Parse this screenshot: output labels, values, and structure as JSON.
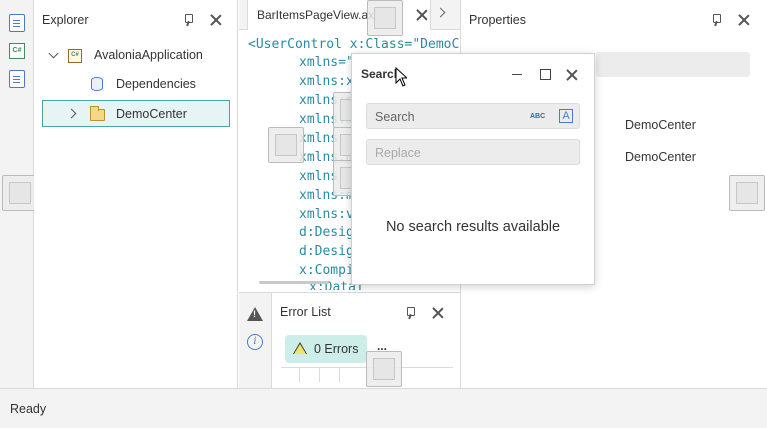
{
  "explorer": {
    "title": "Explorer",
    "tree": [
      {
        "label": "AvaloniaApplication",
        "icon": "csharp-project-icon",
        "expanded": true
      },
      {
        "label": "Dependencies",
        "icon": "database-icon"
      },
      {
        "label": "DemoCenter",
        "icon": "folder-icon",
        "expanded": false,
        "selected": true
      }
    ]
  },
  "editor": {
    "tab_label": "BarItemsPageView.axaml",
    "code_lines": [
      {
        "a": "<UserControl x:Class=\"DemoC"
      },
      {
        "a": "xmlns=\""
      },
      {
        "a": "xmlns:x"
      },
      {
        "a": "xmlns:d"
      },
      {
        "a": "xmlns:m"
      },
      {
        "a": "xmlns:m"
      },
      {
        "a": "xmlns:m"
      },
      {
        "a": "xmlns:m"
      },
      {
        "a": "xmlns:m"
      },
      {
        "a": "xmlns:vi"
      },
      {
        "a": "d:Design"
      },
      {
        "a": "d:Design"
      },
      {
        "a": "x:Compi"
      },
      {
        "a": "x:DataT"
      }
    ]
  },
  "properties": {
    "title": "Properties",
    "values": [
      "DemoCenter",
      "DemoCenter"
    ]
  },
  "error_list": {
    "title": "Error List",
    "badge": "0 Errors",
    "more": "..."
  },
  "search_dialog": {
    "title": "Search",
    "search_placeholder": "Search",
    "replace_placeholder": "Replace",
    "empty_message": "No search results available",
    "abc_label": "ABC"
  },
  "status": {
    "text": "Ready"
  }
}
